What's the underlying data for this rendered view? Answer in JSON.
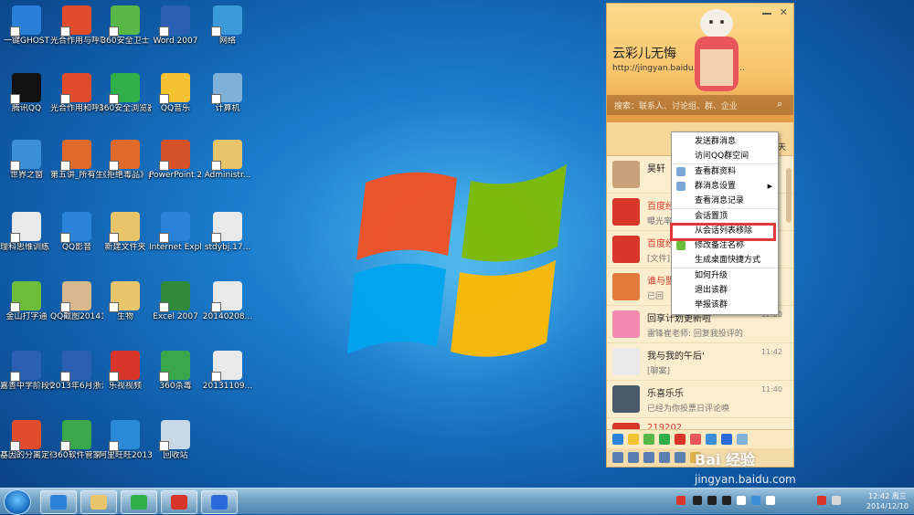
{
  "desktop": {
    "icons": [
      {
        "label": "一键GHOST",
        "name": "ghost-icon",
        "color": "#2a7fd8"
      },
      {
        "label": "光合作用与呼吸作用...",
        "name": "ppt-file-icon",
        "color": "#e04c2c"
      },
      {
        "label": "360安全卫士",
        "name": "360-security-icon",
        "color": "#57b848"
      },
      {
        "label": "Word 2007",
        "name": "word-icon",
        "color": "#2b5fb4"
      },
      {
        "label": "网络",
        "name": "network-icon",
        "color": "#3b9ad8"
      },
      {
        "label": "腾讯QQ",
        "name": "qq-icon",
        "color": "#111111"
      },
      {
        "label": "光合作用和呼吸作用专...",
        "name": "ppt-file-icon",
        "color": "#e04c2c"
      },
      {
        "label": "360安全浏览器7",
        "name": "360-browser-icon",
        "color": "#2fae4a"
      },
      {
        "label": "QQ音乐",
        "name": "qq-music-icon",
        "color": "#f2c230"
      },
      {
        "label": "计算机",
        "name": "computer-icon",
        "color": "#7fb0d8"
      },
      {
        "label": "世界之窗",
        "name": "theworld-browser-icon",
        "color": "#3a8fd8"
      },
      {
        "label": "第五讲_所有生命都需...",
        "name": "ppt-file-icon",
        "color": "#e06a2a"
      },
      {
        "label": "《拒绝毒品》ppt课...",
        "name": "ppt-file-icon",
        "color": "#e06a2a"
      },
      {
        "label": "PowerPoint 2007",
        "name": "powerpoint-icon",
        "color": "#d5512a"
      },
      {
        "label": "Administr...",
        "name": "user-folder-icon",
        "color": "#e8c46a"
      },
      {
        "label": "理科思维训练（一）...",
        "name": "pdf-file-icon",
        "color": "#e9e9e9"
      },
      {
        "label": "QQ影音",
        "name": "qq-player-icon",
        "color": "#2a83d8"
      },
      {
        "label": "新建文件夹",
        "name": "folder-icon",
        "color": "#e8c46a"
      },
      {
        "label": "Internet Explorer",
        "name": "ie-icon",
        "color": "#2a83d8"
      },
      {
        "label": "stdybj.17...",
        "name": "image-file-icon",
        "color": "#e9e9e9"
      },
      {
        "label": "金山打字通",
        "name": "typing-app-icon",
        "color": "#6cbd3a"
      },
      {
        "label": "QQ截图20141208...",
        "name": "image-file-icon",
        "color": "#d8b88c"
      },
      {
        "label": "生物",
        "name": "folder-icon",
        "color": "#e8c46a"
      },
      {
        "label": "Excel 2007",
        "name": "excel-icon",
        "color": "#2f8a3a"
      },
      {
        "label": "20140208...",
        "name": "image-file-icon",
        "color": "#e9e9e9"
      },
      {
        "label": "嘉善中学阶段性考试...",
        "name": "word-file-icon",
        "color": "#2b5fb4"
      },
      {
        "label": "2013年6月浙江省普通高...",
        "name": "word-file-icon",
        "color": "#2b5fb4"
      },
      {
        "label": "乐视视频",
        "name": "letv-icon",
        "color": "#d8362a"
      },
      {
        "label": "360杀毒",
        "name": "360-antivirus-icon",
        "color": "#3aa84a"
      },
      {
        "label": "20131109...",
        "name": "image-file-icon",
        "color": "#e9e9e9"
      },
      {
        "label": "基因的分离定律(第一...",
        "name": "ppt-file-icon",
        "color": "#e04c2c"
      },
      {
        "label": "360软件管家",
        "name": "360-software-icon",
        "color": "#3aa84a"
      },
      {
        "label": "阿里旺旺2013",
        "name": "aliwangwang-icon",
        "color": "#2a8ad8"
      },
      {
        "label": "回收站",
        "name": "recycle-bin-icon",
        "color": "#c9d8e6"
      }
    ]
  },
  "qq": {
    "nickname": "云彩儿无悔",
    "url": "http://jingyan.baidu.com/imag...",
    "search_placeholder": "搜索：联系人、讨论组、群、企业",
    "tab_fragment": "聊天",
    "conversations": [
      {
        "name": "昊轩",
        "msg": "",
        "time": "",
        "color": "#c9a27a"
      },
      {
        "name": "百度经",
        "msg": "曝光率",
        "time": "",
        "color": "#d8362a",
        "red": true
      },
      {
        "name": "百度经",
        "msg": "[文件]",
        "time": "",
        "color": "#d8362a",
        "red": true
      },
      {
        "name": "谁与盟",
        "msg": "已回",
        "time": "",
        "color": "#e27a3a",
        "red": true
      },
      {
        "name": "回享计划更新啦",
        "msg": "雷锋崔老师: 回复我投评的",
        "time": "12:20",
        "color": "#f28ab0"
      },
      {
        "name": "我与我的午后'",
        "msg": "[聊案]",
        "time": "11:42",
        "color": "#e9e9e9"
      },
      {
        "name": "乐喜乐乐",
        "msg": "已经为你投票日评论唤",
        "time": "11:40",
        "color": "#4a5a6a"
      },
      {
        "name": "219202",
        "msg": "",
        "time": "",
        "color": "#d8362a",
        "red": true
      }
    ]
  },
  "context_menu": {
    "items": [
      {
        "label": "发送群消息",
        "sep": false,
        "arrow": false
      },
      {
        "label": "访问QQ群空间",
        "sep": false,
        "arrow": false
      },
      {
        "label": "查看群资料",
        "sep": true,
        "arrow": false
      },
      {
        "label": "群消息设置",
        "sep": false,
        "arrow": true
      },
      {
        "label": "查看消息记录",
        "sep": false,
        "arrow": false
      },
      {
        "label": "会话置顶",
        "sep": true,
        "arrow": false
      },
      {
        "label": "从会话列表移除",
        "sep": false,
        "arrow": false
      },
      {
        "label": "修改备注名称",
        "sep": false,
        "arrow": false
      },
      {
        "label": "生成桌面快捷方式",
        "sep": false,
        "arrow": false
      },
      {
        "label": "如何升级",
        "sep": true,
        "arrow": false
      },
      {
        "label": "退出该群",
        "sep": false,
        "arrow": false
      },
      {
        "label": "举报该群",
        "sep": false,
        "arrow": false
      }
    ],
    "highlighted_index": 6,
    "highlight_color": "#e03a3a"
  },
  "taskbar": {
    "time": "12:42 周三",
    "date": "2014/12/10",
    "buttons": [
      {
        "name": "ie-taskbar-button",
        "color": "#2a83d8"
      },
      {
        "name": "explorer-taskbar-button",
        "color": "#e8c46a"
      },
      {
        "name": "360-browser-taskbar-button",
        "color": "#2fae4a"
      },
      {
        "name": "letv-taskbar-button",
        "color": "#d8362a"
      },
      {
        "name": "baidu-taskbar-button",
        "color": "#2a6ad8"
      }
    ]
  },
  "watermark": {
    "logo": "Bai 经验",
    "site": "jingyan.baidu.com"
  }
}
